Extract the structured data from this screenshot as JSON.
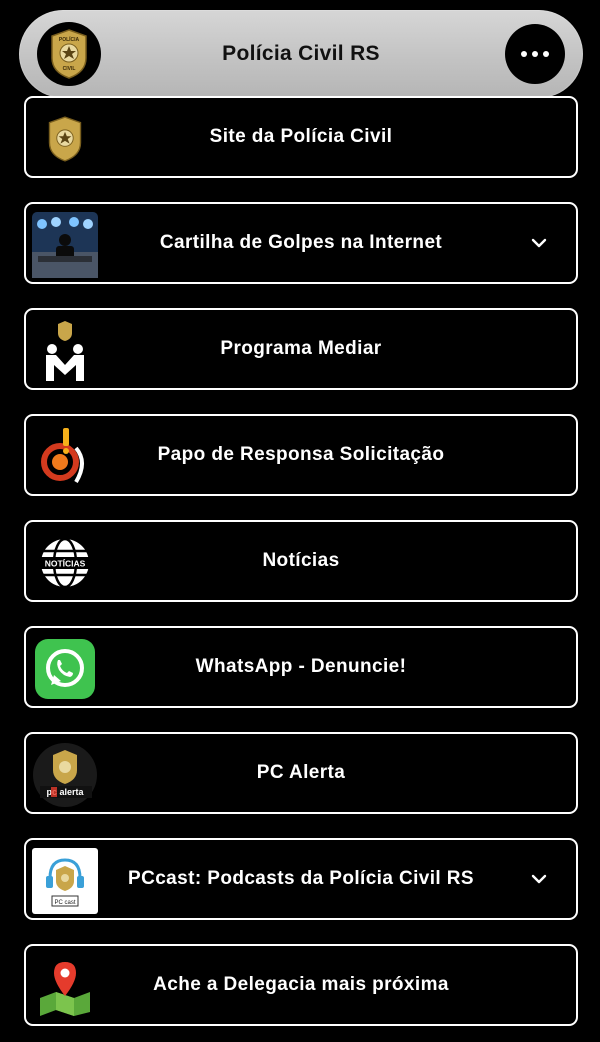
{
  "header": {
    "title": "Polícia Civil RS",
    "badge_icon": "police-badge-icon",
    "menu_icon": "more-horizontal-icon"
  },
  "links": [
    {
      "label": "Site da Polícia Civil",
      "icon": "police-badge-icon",
      "expandable": false
    },
    {
      "label": "Cartilha de Golpes na Internet",
      "icon": "scam-guide-thumbnail",
      "expandable": true
    },
    {
      "label": "Programa Mediar",
      "icon": "mediar-logo-icon",
      "expandable": false
    },
    {
      "label": "Papo de Responsa Solicitação",
      "icon": "papo-de-responsa-logo-icon",
      "expandable": false
    },
    {
      "label": "Notícias",
      "icon": "news-globe-icon",
      "expandable": false
    },
    {
      "label": "WhatsApp - Denuncie!",
      "icon": "whatsapp-icon",
      "expandable": false
    },
    {
      "label": "PC Alerta",
      "icon": "pc-alerta-logo-icon",
      "expandable": false
    },
    {
      "label": "PCcast: Podcasts da Polícia Civil RS",
      "icon": "pccast-logo-icon",
      "expandable": true
    },
    {
      "label": "Ache a Delegacia mais próxima",
      "icon": "map-pin-icon",
      "expandable": false
    }
  ],
  "logo_text": {
    "badge_top": "POLÍCIA",
    "badge_bottom": "CIVIL",
    "noticias": "NOTÍCIAS",
    "pc_alerta": "pc alerta",
    "pccast": "PC cast"
  },
  "colors": {
    "background": "#000000",
    "header_bg": "#c8c8c8",
    "border": "#ffffff",
    "badge_gold": "#c9a64a",
    "whatsapp_green": "#3fc34f",
    "map_pin_red": "#e53b2c"
  }
}
